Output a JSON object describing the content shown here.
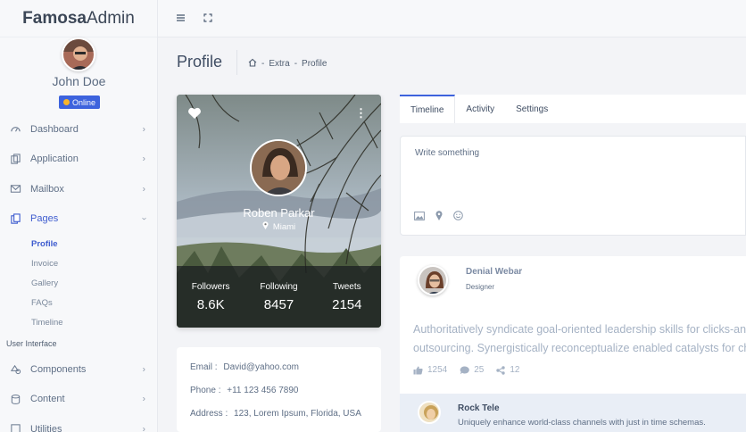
{
  "brand": {
    "bold": "Famosa",
    "regular": "Admin"
  },
  "user": {
    "name": "John Doe",
    "status": "Online"
  },
  "sidebar": {
    "items": [
      {
        "label": "Dashboard",
        "icon": "gauge-icon"
      },
      {
        "label": "Application",
        "icon": "copy-icon"
      },
      {
        "label": "Mailbox",
        "icon": "mail-icon"
      },
      {
        "label": "Pages",
        "icon": "pages-icon"
      }
    ],
    "pages_sub": [
      "Profile",
      "Invoice",
      "Gallery",
      "FAQs",
      "Timeline"
    ],
    "section": "User Interface",
    "items2": [
      {
        "label": "Components",
        "icon": "components-icon"
      },
      {
        "label": "Content",
        "icon": "content-icon"
      },
      {
        "label": "Utilities",
        "icon": "utilities-icon"
      }
    ]
  },
  "page": {
    "title": "Profile",
    "breadcrumb": [
      "Extra",
      "Profile"
    ],
    "sep": "-"
  },
  "profile": {
    "name": "Roben Parkar",
    "location": "Miami",
    "stats": [
      {
        "label": "Followers",
        "value": "8.6K"
      },
      {
        "label": "Following",
        "value": "8457"
      },
      {
        "label": "Tweets",
        "value": "2154"
      }
    ]
  },
  "contact": {
    "email_label": "Email :",
    "email": "David@yahoo.com",
    "phone_label": "Phone :",
    "phone": "+11 123 456 7890",
    "address_label": "Address :",
    "address": "123, Lorem Ipsum, Florida, USA"
  },
  "tabs": [
    "Timeline",
    "Activity",
    "Settings"
  ],
  "composer": {
    "placeholder": "Write something"
  },
  "post": {
    "author": "Denial Webar",
    "role": "Designer",
    "line1": "Authoritatively syndicate goal-oriented leadership skills for clicks-an",
    "line2": "outsourcing. Synergistically reconceptualize enabled catalysts for cha",
    "likes": "1254",
    "comments": "25",
    "shares": "12"
  },
  "reply": {
    "name": "Rock Tele",
    "text": "Uniquely enhance world-class channels with just in time schemas."
  },
  "colors": {
    "accent": "#3d63dd",
    "status_dot": "#f9b52a"
  }
}
